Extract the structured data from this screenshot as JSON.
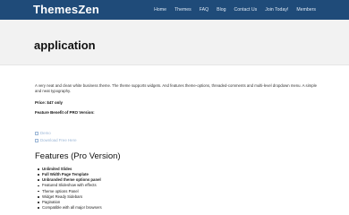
{
  "header": {
    "logo": "ThemesZen",
    "nav": [
      "Home",
      "Themes",
      "FAQ",
      "Blog",
      "Contact Us",
      "Join Today!",
      "Members"
    ]
  },
  "page": {
    "title": "application"
  },
  "content": {
    "description": "A very neat and clean white business theme. The theme supports widgets. And features theme-options, threaded-comments and multi-level dropdown menu. A simple and neat typography.",
    "price": "Price: $47 only",
    "feature_benefit": "Feature Benefit of PRO Version:",
    "link_demo": "Demo",
    "link_download": "Download Free Here",
    "features_title": "Features (Pro Version)",
    "features": [
      "Unlimited Slides",
      "Full Width Page Template",
      "Unbranded theme options panel",
      "Featured Slideshow with effects",
      "Theme options Panel",
      "Widget Ready Sidebars",
      "Pagination",
      "Compatible with all major browsers"
    ]
  }
}
